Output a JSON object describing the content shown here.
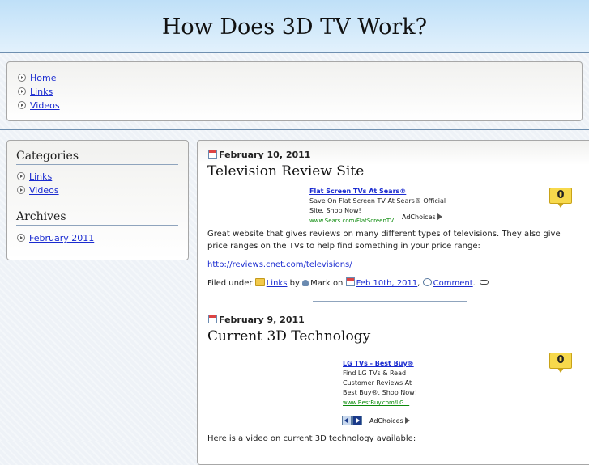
{
  "site": {
    "title": "How Does 3D TV Work?"
  },
  "nav": {
    "items": [
      "Home",
      "Links",
      "Videos"
    ]
  },
  "sidebar": {
    "categories_heading": "Categories",
    "categories": [
      "Links",
      "Videos"
    ],
    "archives_heading": "Archives",
    "archives": [
      "February 2011"
    ]
  },
  "posts": [
    {
      "date": "February 10, 2011",
      "title": "Television Review Site",
      "comment_count": "0",
      "ad": {
        "title": "Flat Screen TVs At Sears®",
        "line1": "Save On Flat Screen TV At Sears® Official",
        "line2": "Site. Shop Now!",
        "url": "www.Sears.com/FlatScreenTV",
        "adchoices": "AdChoices"
      },
      "body": "Great website that gives reviews on many different types of televisions. They also give price ranges on the TVs to help find something in your price range:",
      "link": "http://reviews.cnet.com/televisions/",
      "meta": {
        "filed_under": "Filed under",
        "category": "Links",
        "by": "by",
        "author": "Mark",
        "on": "on",
        "date_link": "Feb 10th, 2011",
        "comma": ",",
        "comment": "Comment",
        "dot": "."
      }
    },
    {
      "date": "February 9, 2011",
      "title": "Current 3D Technology",
      "comment_count": "0",
      "ad": {
        "title": "LG TVs - Best Buy®",
        "line1": "Find LG TVs & Read",
        "line2": "Customer Reviews At",
        "line3": "Best Buy®. Shop Now!",
        "url": "www.BestBuy.com/LG...",
        "adchoices": "AdChoices"
      },
      "body": "Here is a video on current 3D technology available:"
    }
  ]
}
